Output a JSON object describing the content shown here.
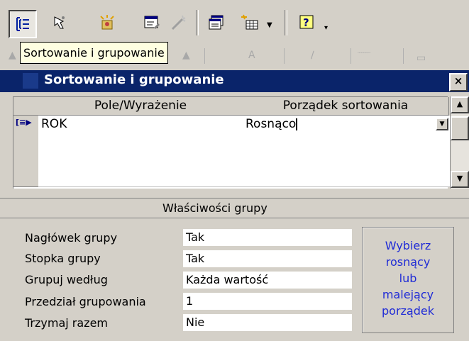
{
  "tooltip": "Sortowanie i grupowanie",
  "dialog": {
    "title": "Sortowanie i grupowanie",
    "close": "×"
  },
  "grid": {
    "columns": [
      "Pole/Wyrażenie",
      "Porządek sortowania"
    ],
    "rows": [
      {
        "field": "ROK",
        "order": "Rosnąco"
      },
      {
        "field": "",
        "order": ""
      },
      {
        "field": "",
        "order": ""
      },
      {
        "field": "",
        "order": ""
      }
    ]
  },
  "group_section": "Właściwości grupy",
  "properties": [
    {
      "label": "Nagłówek grupy",
      "value": "Tak"
    },
    {
      "label": "Stopka grupy",
      "value": "Tak"
    },
    {
      "label": "Grupuj według",
      "value": "Każda wartość"
    },
    {
      "label": "Przedział grupowania",
      "value": "1"
    },
    {
      "label": "Trzymaj razem",
      "value": "Nie"
    }
  ],
  "hint_lines": [
    "Wybierz",
    "rosnący",
    "lub",
    "malejący",
    "porządek"
  ],
  "colors": {
    "titlebar": "#0a246a",
    "hint_text": "#1f2bd6",
    "tooltip_bg": "#ffffe1"
  }
}
